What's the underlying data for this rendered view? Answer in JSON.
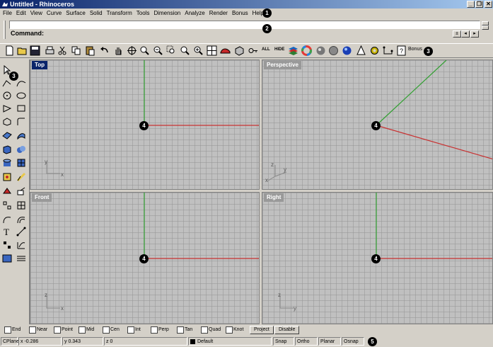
{
  "window": {
    "title": "Untitled - Rhinoceros",
    "minimize": "_",
    "restore": "❐",
    "close": "✕"
  },
  "menu": [
    "File",
    "Edit",
    "View",
    "Curve",
    "Surface",
    "Solid",
    "Transform",
    "Tools",
    "Dimension",
    "Analyze",
    "Render",
    "Bonus",
    "Help"
  ],
  "command": {
    "label": "Command:",
    "history": "",
    "value": ""
  },
  "toolbar": {
    "icons": [
      "new-icon",
      "open-icon",
      "save-icon",
      "print-icon",
      "cut-icon",
      "copy-icon",
      "paste-icon",
      "undo-icon",
      "pan-icon",
      "rotate-view-icon",
      "zoom-icon",
      "zoom-dynamic-icon",
      "zoom-window-icon",
      "zoom-extents-icon",
      "zoom-selected-icon",
      "zoom-all-icon",
      "viewports-4-icon",
      "car-icon",
      "box-icon",
      "hide-icon",
      "layer-icon",
      "color-wheel-icon",
      "sphere-shaded-icon",
      "render-sphere-icon",
      "environment-sphere-icon",
      "light-icon",
      "gear-icon",
      "dimension-icon",
      "help-icon"
    ],
    "all_label": "ALL",
    "hide_label": "HIDE",
    "bonus_label": "Bonus"
  },
  "callouts": [
    "1",
    "2",
    "3",
    "3",
    "4",
    "4",
    "4",
    "4",
    "5"
  ],
  "viewports": [
    {
      "name": "Top",
      "active": true,
      "axis_v": "y",
      "axis_h": "x"
    },
    {
      "name": "Perspective",
      "active": false,
      "axis_v": "z",
      "axis_a": "y",
      "axis_h": "x"
    },
    {
      "name": "Front",
      "active": false,
      "axis_v": "z",
      "axis_h": "x"
    },
    {
      "name": "Right",
      "active": false,
      "axis_v": "z",
      "axis_h": "y"
    }
  ],
  "osnap": {
    "items": [
      "End",
      "Near",
      "Point",
      "Mid",
      "Cen",
      "Int",
      "Perp",
      "Tan",
      "Quad",
      "Knot"
    ],
    "project": "Project",
    "disable": "Disable"
  },
  "status": {
    "cplane": "CPlane",
    "x": "x -0.286",
    "y": "y 0.343",
    "z": "z 0",
    "layer": "Default",
    "snap": "Snap",
    "ortho": "Ortho",
    "planar": "Planar",
    "osnap": "Osnap"
  },
  "colors": {
    "title_bg": "#0a246a",
    "axis_x": "#c83232",
    "axis_y": "#32a032",
    "grid": "#c0c0c0"
  }
}
